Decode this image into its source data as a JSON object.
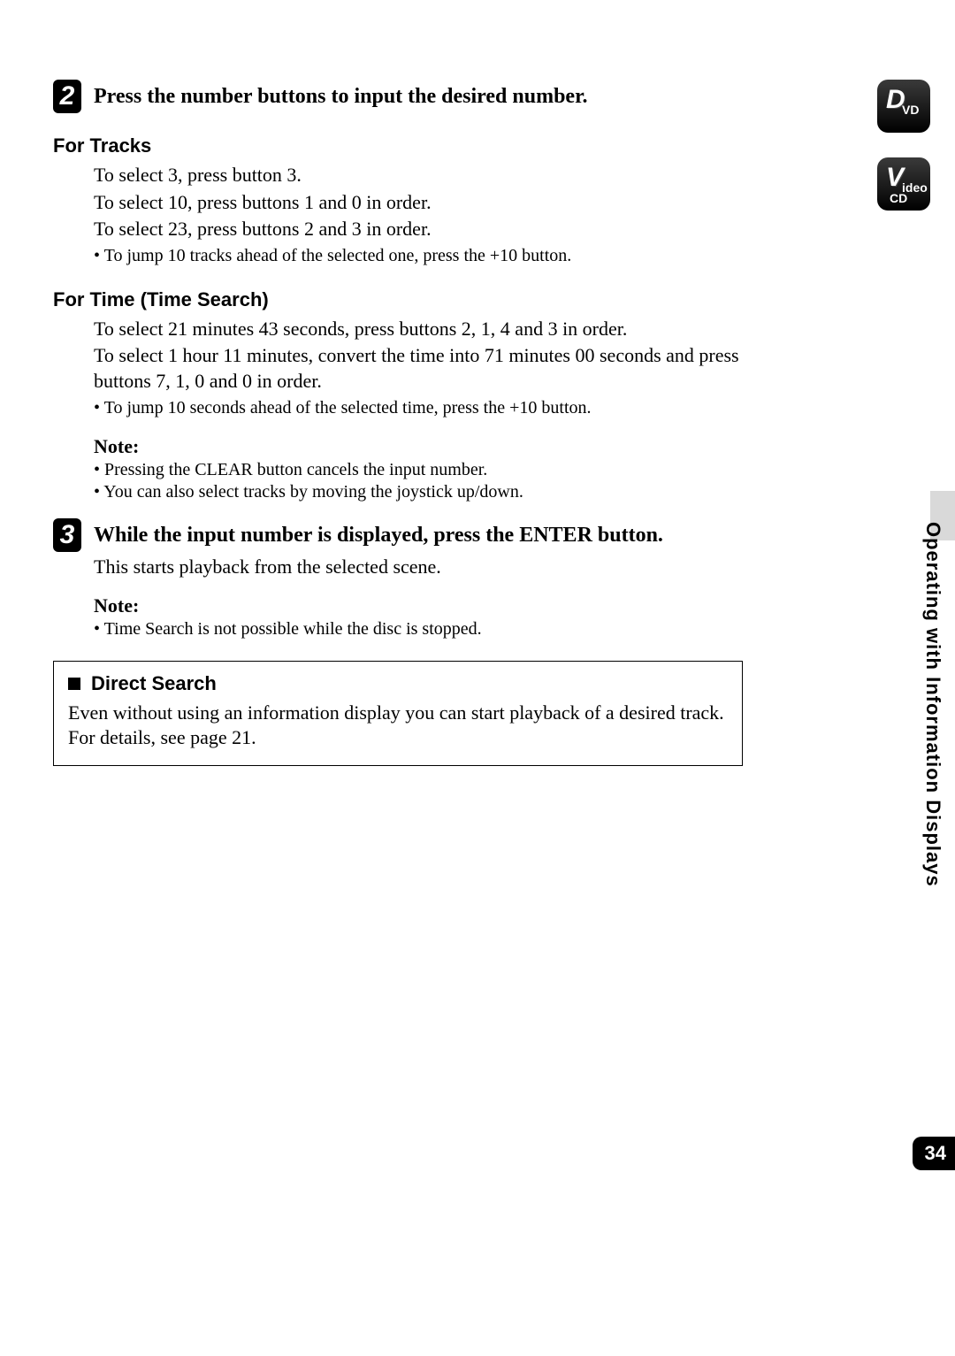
{
  "step2": {
    "num": "2",
    "title": "Press the number buttons to input the desired number."
  },
  "tracks": {
    "heading": "For Tracks",
    "l1": "To select 3, press button 3.",
    "l2": "To select 10, press buttons 1 and 0 in order.",
    "l3": "To select 23, press buttons 2 and 3 in order.",
    "l4": "• To jump 10 tracks ahead of the selected one, press the +10 button."
  },
  "time": {
    "heading": "For Time (Time Search)",
    "l1": "To select 21 minutes 43 seconds, press buttons 2, 1, 4 and 3 in order.",
    "l2": "To select 1 hour 11 minutes, convert the time into 71 minutes 00 seconds and press buttons 7, 1, 0 and 0 in order.",
    "l3": "• To jump 10 seconds ahead of the selected time, press the +10 button."
  },
  "note1": {
    "label": "Note:",
    "i1": "•  Pressing the CLEAR button cancels the input number.",
    "i2": "•  You can also select tracks by moving the joystick up/down."
  },
  "step3": {
    "num": "3",
    "title": "While the input number is displayed, press the ENTER button.",
    "desc": "This starts playback from the selected scene."
  },
  "note2": {
    "label": "Note:",
    "i1": "•  Time Search is not possible while the disc is stopped."
  },
  "box": {
    "heading": "Direct Search",
    "body": "Even without using an information display you can start playback of a desired track. For details, see page 21."
  },
  "side": {
    "dvd_main": "D",
    "dvd_sub": "VD",
    "vcd_main": "V",
    "vcd_sub": "ideo",
    "vcd_sub2": "CD",
    "vertical": "Operating with Information Displays",
    "page": "34"
  }
}
